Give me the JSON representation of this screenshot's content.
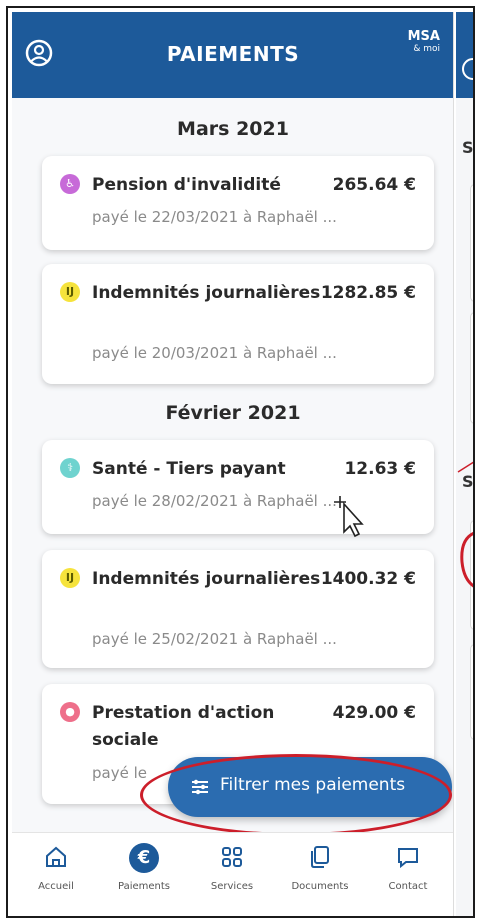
{
  "header": {
    "title": "PAIEMENTS",
    "logo_top": "MSA",
    "logo_bottom": "& moi"
  },
  "months": [
    {
      "label": "Mars 2021",
      "payments": [
        {
          "label": "Pension d'invalidité",
          "amount": "265.64 €",
          "sub": "payé le 22/03/2021 à Raphaël ...",
          "icon": "wheelchair-icon",
          "icon_color": "#c76ad8"
        },
        {
          "label": "Indemnités journalières",
          "amount": "1282.85 €",
          "sub": "payé le 20/03/2021 à Raphaël ...",
          "icon": "ij-icon",
          "icon_color": "#f6e33c"
        }
      ]
    },
    {
      "label": "Février 2021",
      "payments": [
        {
          "label": "Santé - Tiers payant",
          "amount": "12.63 €",
          "sub": "payé le 28/02/2021 à Raphaël ...",
          "icon": "stethoscope-icon",
          "icon_color": "#6fd3cf"
        },
        {
          "label": "Indemnités journalières",
          "amount": "1400.32 €",
          "sub": "payé le 25/02/2021 à Raphaël ...",
          "icon": "ij-icon",
          "icon_color": "#f6e33c"
        },
        {
          "label": "Prestation d'action sociale",
          "amount": "429.00 €",
          "sub": "payé le",
          "icon": "social-action-icon",
          "icon_color": "#ee6f8a"
        }
      ]
    }
  ],
  "filter_button": {
    "label": "Filtrer mes paiements"
  },
  "nav": [
    {
      "label": "Accueil",
      "icon": "home-icon"
    },
    {
      "label": "Paiements",
      "icon": "euro-icon",
      "active": true
    },
    {
      "label": "Services",
      "icon": "grid-icon"
    },
    {
      "label": "Documents",
      "icon": "documents-icon"
    },
    {
      "label": "Contact",
      "icon": "chat-icon"
    }
  ],
  "side_panel": {
    "letters": [
      "S",
      "S"
    ]
  },
  "colors": {
    "primary": "#1d5a9a",
    "button": "#2b6cb0",
    "annotation": "#cc1e2a"
  }
}
